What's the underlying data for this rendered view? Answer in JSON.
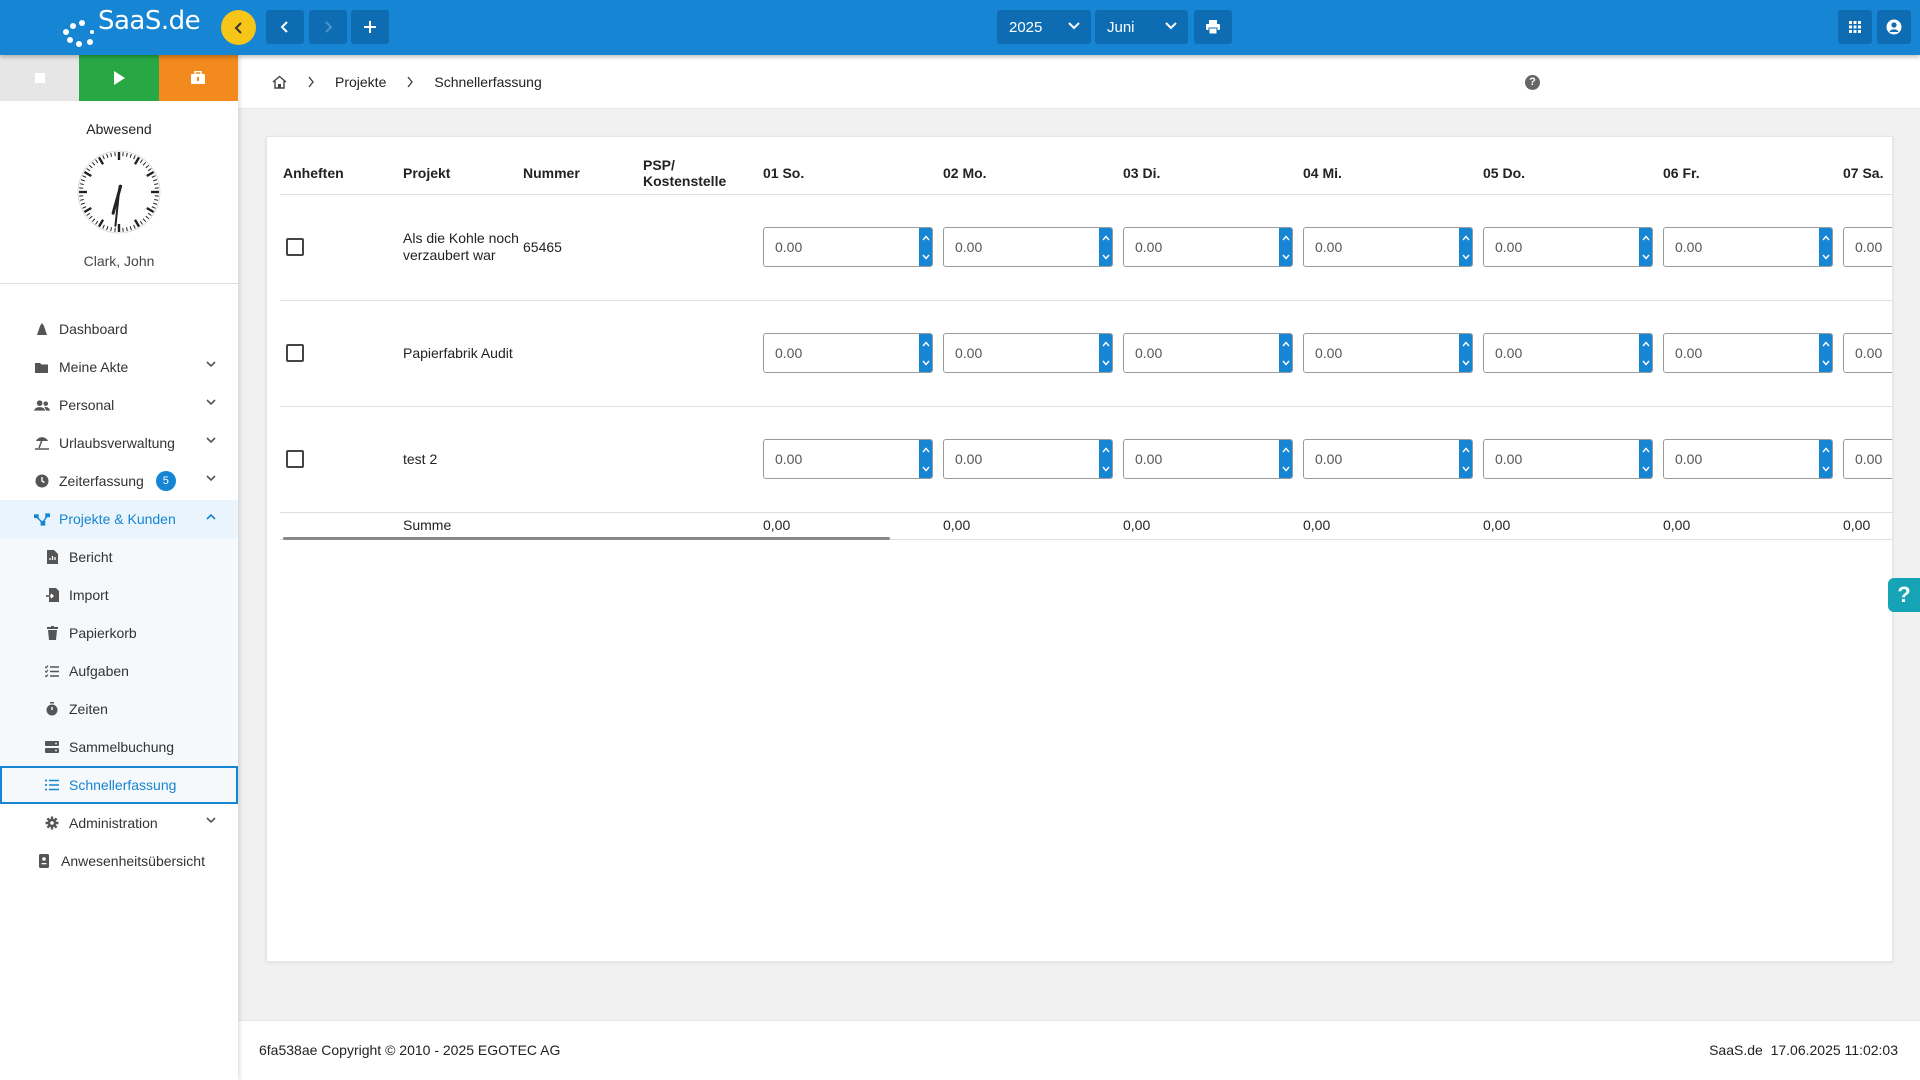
{
  "brand": {
    "logo_text": "SaaS.de"
  },
  "toolbar": {
    "year": "2025",
    "month": "Juni"
  },
  "colors": {
    "primary": "#1585d4",
    "play": "#27a844",
    "pause": "#f28a1e",
    "collapse": "#f5c518"
  },
  "sidebar": {
    "status": "Abwesend",
    "user": "Clark, John",
    "clock": {
      "hour": 6,
      "minute": 31
    },
    "nav": [
      {
        "label": "Dashboard",
        "icon": "dashboard-icon"
      },
      {
        "label": "Meine Akte",
        "icon": "folder-icon"
      },
      {
        "label": "Personal",
        "icon": "users-icon"
      },
      {
        "label": "Urlaubsverwaltung",
        "icon": "beach-icon"
      },
      {
        "label": "Zeiterfassung",
        "icon": "clock-icon",
        "badge": "5"
      },
      {
        "label": "Projekte & Kunden",
        "icon": "project-icon"
      },
      {
        "label": "Bericht",
        "icon": "report-icon"
      },
      {
        "label": "Import",
        "icon": "import-icon"
      },
      {
        "label": "Papierkorb",
        "icon": "trash-icon"
      },
      {
        "label": "Aufgaben",
        "icon": "tasks-icon"
      },
      {
        "label": "Zeiten",
        "icon": "stopwatch-icon"
      },
      {
        "label": "Sammelbuchung",
        "icon": "batch-icon"
      },
      {
        "label": "Schnellerfassung",
        "icon": "list-icon"
      },
      {
        "label": "Administration",
        "icon": "gear-icon"
      },
      {
        "label": "Anwesenheitsübersicht",
        "icon": "id-icon"
      }
    ]
  },
  "breadcrumb": {
    "level1": "Projekte",
    "level2": "Schnellerfassung"
  },
  "table": {
    "headers": {
      "pin": "Anheften",
      "project": "Projekt",
      "number": "Nummer",
      "psp_line1": "PSP/",
      "psp_line2": "Kostenstelle",
      "days": [
        "01 So.",
        "02 Mo.",
        "03 Di.",
        "04 Mi.",
        "05 Do.",
        "06 Fr.",
        "07 Sa."
      ]
    },
    "rows": [
      {
        "project": "Als die Kohle noch verzaubert war",
        "number": "65465",
        "values": [
          "0.00",
          "0.00",
          "0.00",
          "0.00",
          "0.00",
          "0.00",
          "0.00"
        ]
      },
      {
        "project": "Papierfabrik Audit",
        "number": "",
        "values": [
          "0.00",
          "0.00",
          "0.00",
          "0.00",
          "0.00",
          "0.00",
          "0.00"
        ]
      },
      {
        "project": "test 2",
        "number": "",
        "values": [
          "0.00",
          "0.00",
          "0.00",
          "0.00",
          "0.00",
          "0.00",
          "0.00"
        ]
      }
    ],
    "sum_label": "Summe",
    "sums": [
      "0,00",
      "0,00",
      "0,00",
      "0,00",
      "0,00",
      "0,00",
      "0,00"
    ]
  },
  "footer": {
    "copyright": "6fa538ae Copyright © 2010 - 2025 EGOTEC AG",
    "app": "SaaS.de",
    "timestamp": "17.06.2025 11:02:03"
  }
}
